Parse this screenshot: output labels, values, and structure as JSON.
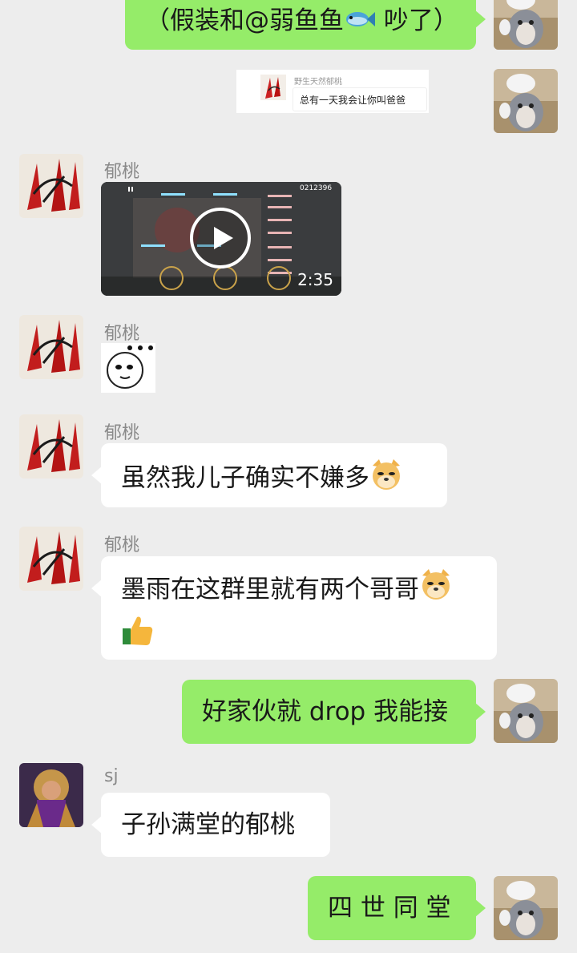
{
  "messages": {
    "m1": {
      "text_before": "（假装和@弱鱼鱼",
      "text_after": " 吵了）",
      "emoji": "fish-emoji"
    },
    "m2": {
      "quote_sender": "野生天然郁桃",
      "quote_text": "总有一天我会让你叫爸爸"
    },
    "m3": {
      "sender": "郁桃",
      "video_counter": "0212396",
      "video_duration": "2:35"
    },
    "m4": {
      "sender": "郁桃",
      "sticker": "ellipsis-face-sticker"
    },
    "m5": {
      "sender": "郁桃",
      "text": "虽然我儿子确实不嫌多",
      "emoji": "doge-emoji"
    },
    "m6": {
      "sender": "郁桃",
      "text": "墨雨在这群里就有两个哥哥",
      "emoji": "doge-emoji",
      "emoji2": "thumbs-up-emoji"
    },
    "m7": {
      "text": "好家伙就 drop 我能接"
    },
    "m8": {
      "sender": "sj",
      "text": "子孙满堂的郁桃"
    },
    "m9": {
      "text": "四 世 同 堂"
    }
  },
  "colors": {
    "background": "#ededed",
    "self_bubble": "#95ec69",
    "other_bubble": "#ffffff",
    "name": "#8a8a8a"
  }
}
